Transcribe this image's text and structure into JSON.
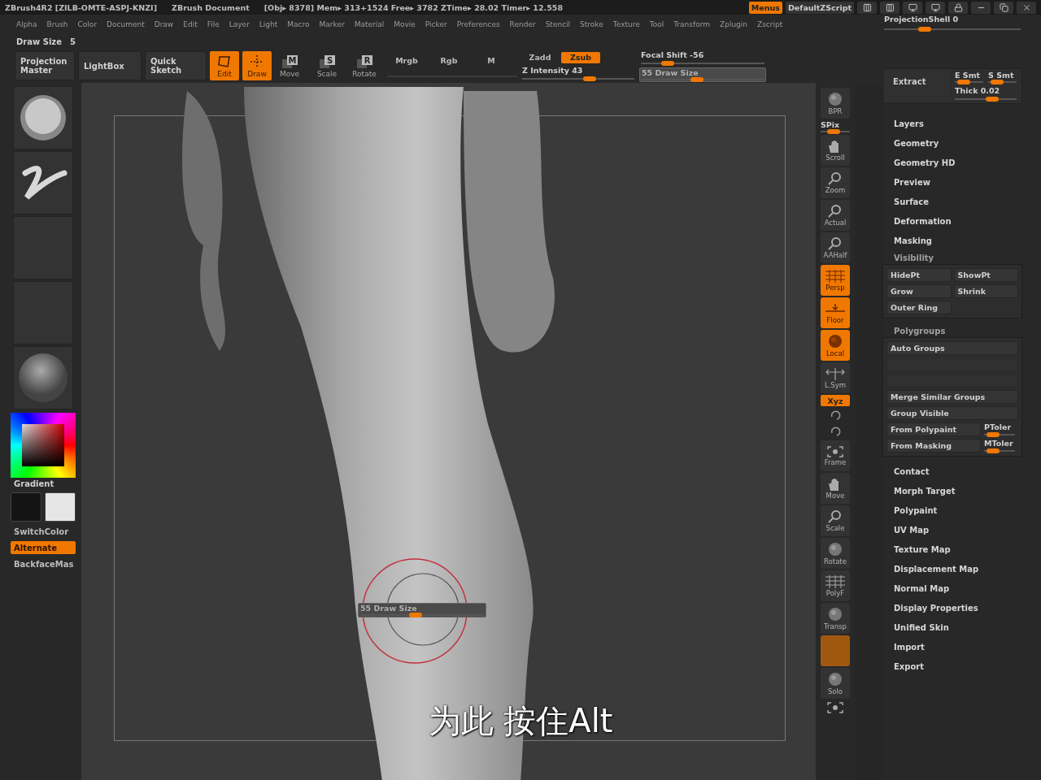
{
  "title_bar": {
    "app": "ZBrush4R2 [ZILB-OMTE-ASPJ-KNZI]",
    "document": "ZBrush Document",
    "stats": "[Obj▸ 8378] Mem▸ 313+1524 Free▸ 3782 ZTime▸ 28.02 Timer▸ 12.558",
    "buttons": [
      {
        "label": "Menus",
        "selected": true
      },
      {
        "label": "DefaultZScript",
        "selected": false
      }
    ]
  },
  "menu_bar": [
    "Alpha",
    "Brush",
    "Color",
    "Document",
    "Draw",
    "Edit",
    "File",
    "Layer",
    "Light",
    "Macro",
    "Marker",
    "Material",
    "Movie",
    "Picker",
    "Preferences",
    "Render",
    "Stencil",
    "Stroke",
    "Texture",
    "Tool",
    "Transform",
    "Zplugin",
    "Zscript"
  ],
  "draw_size_readout": {
    "label": "Draw Size",
    "value": "5"
  },
  "toolbar": {
    "buttons": [
      "Projection Master",
      "LightBox",
      "Quick Sketch"
    ],
    "modes": [
      {
        "label": "Edit",
        "active": true
      },
      {
        "label": "Draw",
        "active": true
      },
      {
        "label": "Move",
        "badge": "M",
        "active": false
      },
      {
        "label": "Scale",
        "badge": "S",
        "active": false
      },
      {
        "label": "Rotate",
        "badge": "R",
        "active": false
      }
    ],
    "color_toggles": [
      {
        "label": "Mrgb",
        "active": false
      },
      {
        "label": "Rgb",
        "active": false
      },
      {
        "label": "M",
        "active": false
      }
    ],
    "z_toggles": [
      {
        "label": "Zadd",
        "active": false
      },
      {
        "label": "Zsub",
        "active": true
      }
    ],
    "z_intensity": {
      "label": "Z Intensity 43",
      "level": 0.6
    },
    "focal_shift": {
      "label": "Focal Shift -56",
      "level": 0.22
    },
    "draw_size": {
      "label": "55 Draw Size",
      "level": 0.45
    }
  },
  "left_shelf": {
    "thumbnails": [
      {
        "kind": "sphere"
      },
      {
        "kind": "stroke"
      },
      {
        "kind": "empty"
      },
      {
        "kind": "empty"
      },
      {
        "kind": "matcap"
      }
    ],
    "gradient_label": "Gradient",
    "swatches": [
      {
        "color": "#141414"
      },
      {
        "color": "#e6e6e6"
      }
    ],
    "buttons": [
      {
        "label": "SwitchColor",
        "active": false
      },
      {
        "label": "Alternate",
        "active": true
      },
      {
        "label": "BackfaceMas",
        "active": false
      }
    ]
  },
  "canvas": {
    "floating_slider": {
      "label": "55 Draw Size",
      "level": 0.45
    },
    "subtitle": "为此 按住Alt"
  },
  "right_shelf": [
    {
      "kind": "button",
      "label": "BPR",
      "active": false
    },
    {
      "kind": "slider",
      "label": "SPix",
      "level": 0.45
    },
    {
      "kind": "button",
      "label": "Scroll",
      "active": false
    },
    {
      "kind": "button",
      "label": "Zoom",
      "active": false
    },
    {
      "kind": "button",
      "label": "Actual",
      "active": false
    },
    {
      "kind": "button",
      "label": "AAHalf",
      "active": false
    },
    {
      "kind": "button",
      "label": "Persp",
      "active": true
    },
    {
      "kind": "button",
      "label": "Floor",
      "active": true
    },
    {
      "kind": "button",
      "label": "Local",
      "active": true
    },
    {
      "kind": "button",
      "label": "L.Sym",
      "active": false
    },
    {
      "kind": "toggle",
      "label": "Xyz",
      "active": true
    },
    {
      "kind": "mini"
    },
    {
      "kind": "mini"
    },
    {
      "kind": "button",
      "label": "Frame",
      "active": false
    },
    {
      "kind": "button",
      "label": "Move",
      "active": false
    },
    {
      "kind": "button",
      "label": "Scale",
      "active": false
    },
    {
      "kind": "button",
      "label": "Rotate",
      "active": false
    },
    {
      "kind": "button",
      "label": "PolyF",
      "active": false
    },
    {
      "kind": "button",
      "label": "Transp",
      "active": false
    },
    {
      "kind": "blank",
      "active": true
    },
    {
      "kind": "button",
      "label": "Solo",
      "active": false
    },
    {
      "kind": "mini"
    }
  ],
  "tool_panel": {
    "projection_shell": {
      "label": "ProjectionShell 0",
      "level": 0.3
    },
    "extract": {
      "button": "Extract",
      "sliders": [
        {
          "label": "E Smt",
          "level": 0.3
        },
        {
          "label": "S Smt",
          "level": 0.3
        },
        {
          "label": "Thick 0.02",
          "level": 0.6
        }
      ]
    },
    "subpalettes_top": [
      "Layers",
      "Geometry",
      "Geometry HD",
      "Preview",
      "Surface",
      "Deformation",
      "Masking"
    ],
    "visibility": {
      "title": "Visibility",
      "buttons": [
        "HidePt",
        "ShowPt",
        "Grow",
        "Shrink",
        "Outer Ring"
      ]
    },
    "polygroups": {
      "title": "Polygroups",
      "rows": [
        {
          "kind": "button",
          "label": "Auto Groups"
        },
        {
          "kind": "disabled"
        },
        {
          "kind": "disabled"
        },
        {
          "kind": "button",
          "label": "Merge Similar Groups"
        },
        {
          "kind": "button",
          "label": "Group Visible"
        },
        {
          "kind": "with_slider",
          "label": "From Polypaint",
          "slider": "PToler",
          "level": 0.3
        },
        {
          "kind": "with_slider",
          "label": "From Masking",
          "slider": "MToler",
          "level": 0.3
        }
      ]
    },
    "subpalettes_bottom": [
      "Contact",
      "Morph Target",
      "Polypaint",
      "UV Map",
      "Texture Map",
      "Displacement Map",
      "Normal Map",
      "Display Properties",
      "Unified Skin",
      "Import",
      "Export"
    ]
  }
}
